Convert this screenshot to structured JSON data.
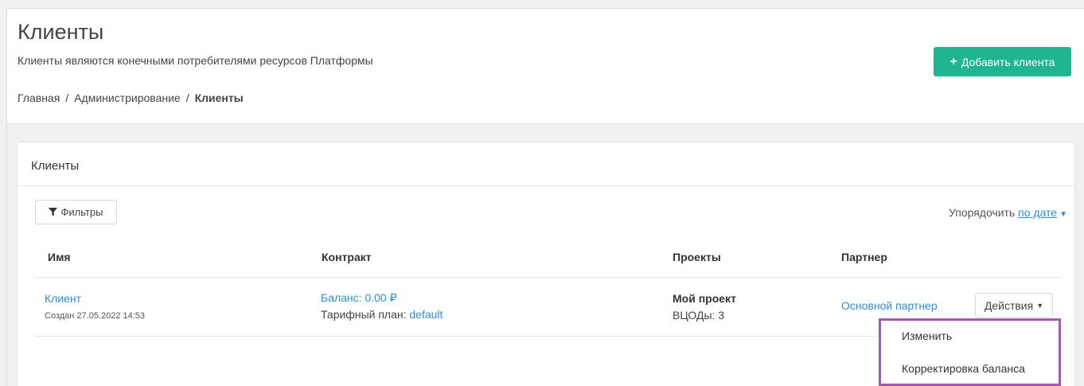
{
  "header": {
    "title": "Клиенты",
    "subtitle": "Клиенты являются конечными потребителями ресурсов Платформы",
    "add_button": {
      "icon": "plus-icon",
      "label": "Добавить клиента"
    },
    "breadcrumb": {
      "items": [
        "Главная",
        "Администрирование"
      ],
      "current": "Клиенты",
      "separator": "/"
    }
  },
  "card": {
    "title": "Клиенты",
    "filter_button": {
      "icon": "filter-icon",
      "label": "Фильтры"
    },
    "sort": {
      "label": "Упорядочить",
      "value": "по дате"
    }
  },
  "table": {
    "columns": [
      "Имя",
      "Контракт",
      "Проекты",
      "Партнер"
    ],
    "rows": [
      {
        "name": "Клиент",
        "created": "Создан 27.05.2022 14:53",
        "balance": "Баланс: 0.00 ₽",
        "tariff_label": "Тарифный план:",
        "tariff_value": "default",
        "project": "Мой проект",
        "vcpu": "ВЦОДы: 3",
        "partner": "Основной партнер",
        "actions_label": "Действия"
      }
    ]
  },
  "dropdown": {
    "items": [
      "Изменить",
      "Корректировка баланса"
    ]
  },
  "colors": {
    "accent_green": "#1fb590",
    "link_blue": "#2b8fd6",
    "highlight_purple": "#a35bab"
  }
}
